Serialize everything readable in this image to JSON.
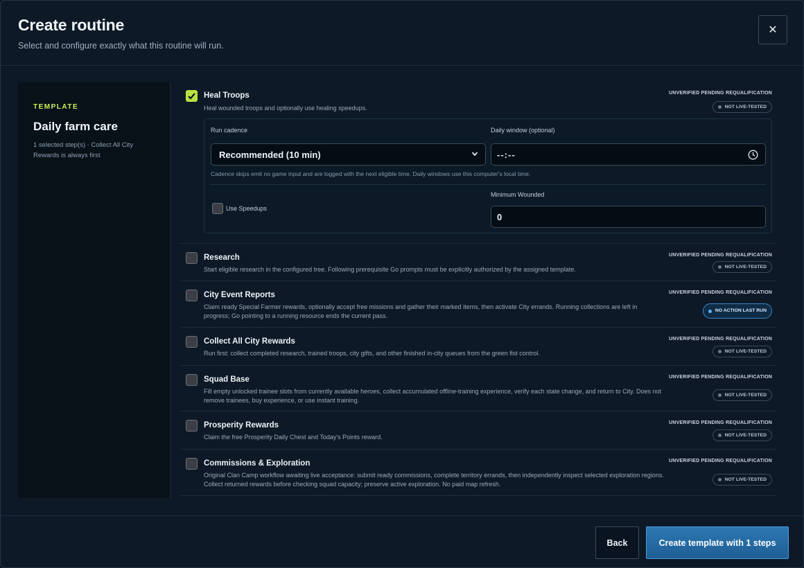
{
  "header": {
    "title": "Create routine",
    "subtitle": "Select and configure exactly what this routine will run.",
    "close_label": "✕"
  },
  "template": {
    "section_label": "TEMPLATE",
    "name": "Daily farm care",
    "summary": "1 selected step(s) · Collect All City Rewards is always first"
  },
  "steps": [
    {
      "title": "Heal Troops",
      "description": "Heal wounded troops and optionally use healing speedups.",
      "checked": true,
      "status": "UNVERIFIED PENDING REQUALIFICATION",
      "badge": "NOT LIVE-TESTED",
      "config": {
        "cadence_label": "Run cadence",
        "cadence_value": "Recommended (10 min)",
        "window_label": "Daily window (optional)",
        "window_value": "--:--",
        "note": "Cadence skips emit no game input and are logged with the next eligible time. Daily windows use this computer's local time.",
        "speedups_label": "Use Speedups",
        "min_wounded_label": "Minimum Wounded",
        "min_wounded_value": "0"
      }
    },
    {
      "title": "Research",
      "description": "Start eligible research in the configured tree. Following prerequisite Go prompts must be explicitly authorized by the assigned template.",
      "checked": false,
      "status": "UNVERIFIED PENDING REQUALIFICATION",
      "badge": "NOT LIVE-TESTED"
    },
    {
      "title": "City Event Reports",
      "description": "Claim ready Special Farmer rewards, optionally accept free missions and gather their marked items, then activate City errands. Running collections are left in progress; Go pointing to a running resource ends the current pass.",
      "checked": false,
      "status": "UNVERIFIED PENDING REQUALIFICATION",
      "badge": "NO ACTION LAST RUN"
    },
    {
      "title": "Collect All City Rewards",
      "description": "Run first: collect completed research, trained troops, city gifts, and other finished in-city queues from the green fist control.",
      "checked": false,
      "status": "UNVERIFIED PENDING REQUALIFICATION",
      "badge": "NOT LIVE-TESTED"
    },
    {
      "title": "Squad Base",
      "description": "Fill empty unlocked trainee slots from currently available heroes, collect accumulated offline-training experience, verify each state change, and return to City. Does not remove trainees, buy experience, or use instant training.",
      "checked": false,
      "status": "UNVERIFIED PENDING REQUALIFICATION",
      "badge": "NOT LIVE-TESTED"
    },
    {
      "title": "Prosperity Rewards",
      "description": "Claim the free Prosperity Daily Chest and Today's Points reward.",
      "checked": false,
      "status": "UNVERIFIED PENDING REQUALIFICATION",
      "badge": "NOT LIVE-TESTED"
    },
    {
      "title": "Commissions & Exploration",
      "description": "Original Clan Camp workflow awaiting live acceptance: submit ready commissions, complete territory errands, then independently inspect selected exploration regions. Collect returned rewards before checking squad capacity; preserve active exploration. No paid map refresh.",
      "checked": false,
      "status": "UNVERIFIED PENDING REQUALIFICATION",
      "badge": "NOT LIVE-TESTED"
    }
  ],
  "footer": {
    "back_label": "Back",
    "create_label": "Create template with 1 steps"
  }
}
